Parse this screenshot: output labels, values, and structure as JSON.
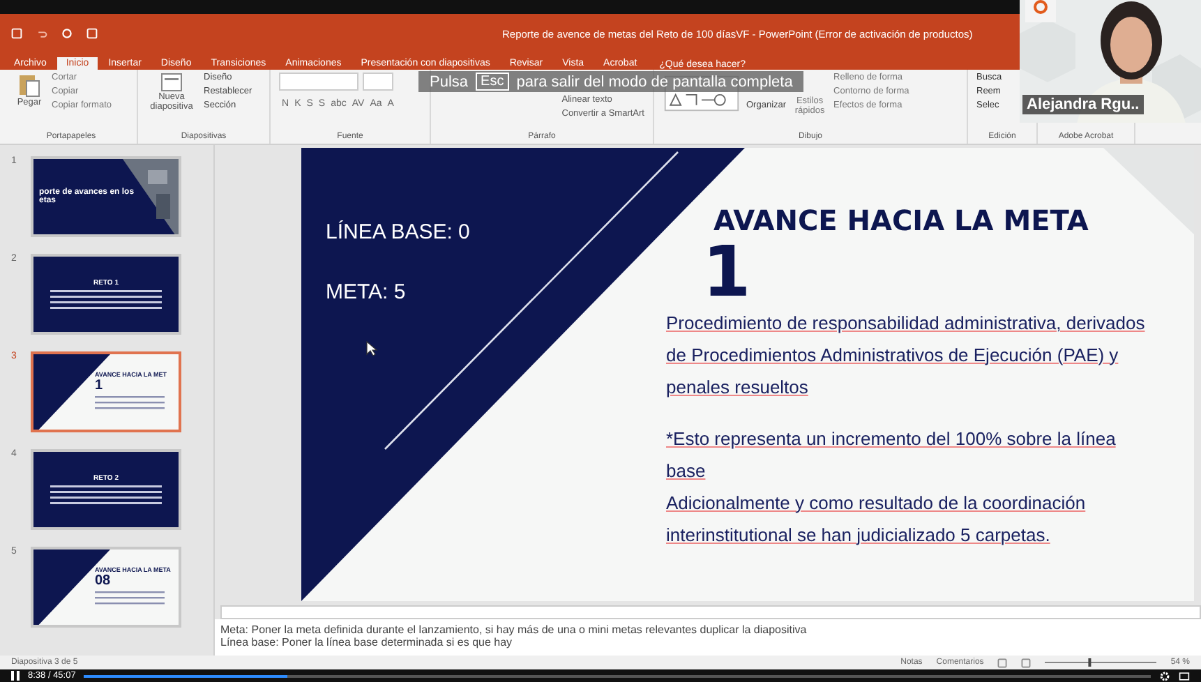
{
  "title_bar": {
    "title": "Reporte de avence de metas del Reto de 100 díasVF - PowerPoint (Error de activación de productos)"
  },
  "tabs": [
    {
      "label": "Archivo",
      "selected": false
    },
    {
      "label": "Inicio",
      "selected": true
    },
    {
      "label": "Insertar",
      "selected": false
    },
    {
      "label": "Diseño",
      "selected": false
    },
    {
      "label": "Transiciones",
      "selected": false
    },
    {
      "label": "Animaciones",
      "selected": false
    },
    {
      "label": "Presentación con diapositivas",
      "selected": false
    },
    {
      "label": "Revisar",
      "selected": false
    },
    {
      "label": "Vista",
      "selected": false
    },
    {
      "label": "Acrobat",
      "selected": false
    }
  ],
  "tell_me": "¿Qué desea hacer?",
  "ribbon": {
    "clipboard": {
      "label": "Portapapeles",
      "paste": "Pegar",
      "items": [
        "Cortar",
        "Copiar",
        "Copiar formato"
      ]
    },
    "slides": {
      "label": "Diapositivas",
      "new_slide": "Nueva diapositiva",
      "items": [
        "Diseño",
        "Restablecer",
        "Sección"
      ]
    },
    "font": {
      "label": "Fuente",
      "buttons": [
        "N",
        "K",
        "S",
        "S",
        "abc",
        "AV",
        "Aa",
        "A"
      ]
    },
    "paragraph": {
      "label": "Párrafo",
      "items": [
        "Alinear texto",
        "Convertir a SmartArt"
      ]
    },
    "drawing": {
      "label": "Dibujo",
      "arrange": "Organizar",
      "quick_styles": "Estilos rápidos",
      "items": [
        "Relleno de forma",
        "Contorno de forma",
        "Efectos de forma"
      ]
    },
    "editing": {
      "label": "Edición",
      "items": [
        "Busca",
        "Reem",
        "Selec"
      ]
    },
    "acrobat": {
      "label": "Adobe Acrobat"
    }
  },
  "fullscreen_notice": {
    "before": "Pulsa",
    "key": "Esc",
    "after": "para salir del modo de pantalla completa"
  },
  "video": {
    "name": "Alejandra Rgu.."
  },
  "thumbnails": [
    {
      "number": "1",
      "kind": "title",
      "selected": false,
      "title": "porte de avances en los",
      "subtitle": "etas"
    },
    {
      "number": "2",
      "kind": "reto",
      "selected": false,
      "title": "RETO 1"
    },
    {
      "number": "3",
      "kind": "avance",
      "selected": true,
      "title": "AVANCE HACIA LA MET",
      "value": "1"
    },
    {
      "number": "4",
      "kind": "reto",
      "selected": false,
      "title": "RETO 2"
    },
    {
      "number": "5",
      "kind": "avance",
      "selected": false,
      "title": "AVANCE HACIA LA META",
      "value": "08"
    }
  ],
  "slide": {
    "baseline": "LÍNEA BASE: 0",
    "goal": "META: 5",
    "title": "AVANCE HACIA LA META",
    "value": "1",
    "paragraphs": [
      "Procedimiento de responsabilidad administrativa, derivados de Procedimientos Administrativos de Ejecución (PAE) y penales resueltos",
      "*Esto representa un incremento del 100% sobre la línea base",
      "Adicionalmente y como resultado de la coordinación interinstitutional se han judicializado 5 carpetas."
    ]
  },
  "notes": [
    "Meta: Poner la meta definida durante el lanzamiento, si hay más de una o mini metas relevantes duplicar la diapositiva",
    "Línea base: Poner la línea base determinada si es que hay"
  ],
  "status_bar": {
    "slide": "Diapositiva 3 de 5",
    "notes": "Notas",
    "comments": "Comentarios",
    "zoom": "54 %",
    "zoom_slider": {
      "level": 0.4
    }
  },
  "player": {
    "time": "8:38 / 45:07",
    "level": 0.19
  }
}
